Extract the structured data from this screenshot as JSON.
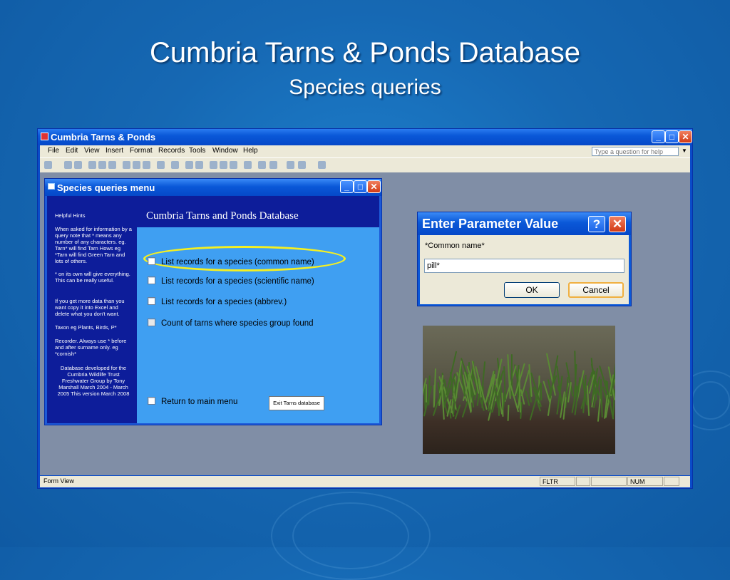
{
  "slide": {
    "title": "Cumbria Tarns & Ponds Database",
    "subtitle": "Species queries"
  },
  "app": {
    "title": "Cumbria Tarns & Ponds",
    "menu": [
      "File",
      "Edit",
      "View",
      "Insert",
      "Format",
      "Records",
      "Tools",
      "Window",
      "Help"
    ],
    "help_placeholder": "Type a question for help",
    "status": {
      "view": "Form View",
      "fltr": "FLTR",
      "num": "NUM"
    }
  },
  "form": {
    "title": "Species queries menu",
    "heading": "Cumbria Tarns and Ponds Database",
    "hints": [
      "Helpful Hints",
      "When asked for information by a query note that * means any number of any characters. eg. Tarn* will find Tarn Hows eg *Tarn will find Green Tarn and lots of others.",
      "* on its own will give everything. This can be really useful.",
      "If you get more data than you want copy it into Excel and delete what you don't want.",
      "Taxon eg Plants, Birds, P*",
      "Recorder. Always use * before and after surname only. eg *cornish*",
      "Database developed for the Cumbria Wildlife Trust Freshwater Group by Tony Marshall March 2004 - March 2005 This version March 2008"
    ],
    "options": [
      "List records for a species (common name)",
      "List records for a species (scientific name)",
      "List records for a species (abbrev.)",
      "Count of tarns where species group found"
    ],
    "return_label": "Return to main menu",
    "exit_label": "Exit Tarns database"
  },
  "dialog": {
    "title": "Enter Parameter Value",
    "label": "*Common name*",
    "value": "pill*",
    "ok_label": "OK",
    "cancel_label": "Cancel"
  },
  "colors": {
    "slide_bg": "#1668b3",
    "titlebar": "#0a58d8",
    "form_body": "#3f9ff2",
    "hints_panel": "#0d1d9a",
    "highlight": "#f6f020"
  }
}
